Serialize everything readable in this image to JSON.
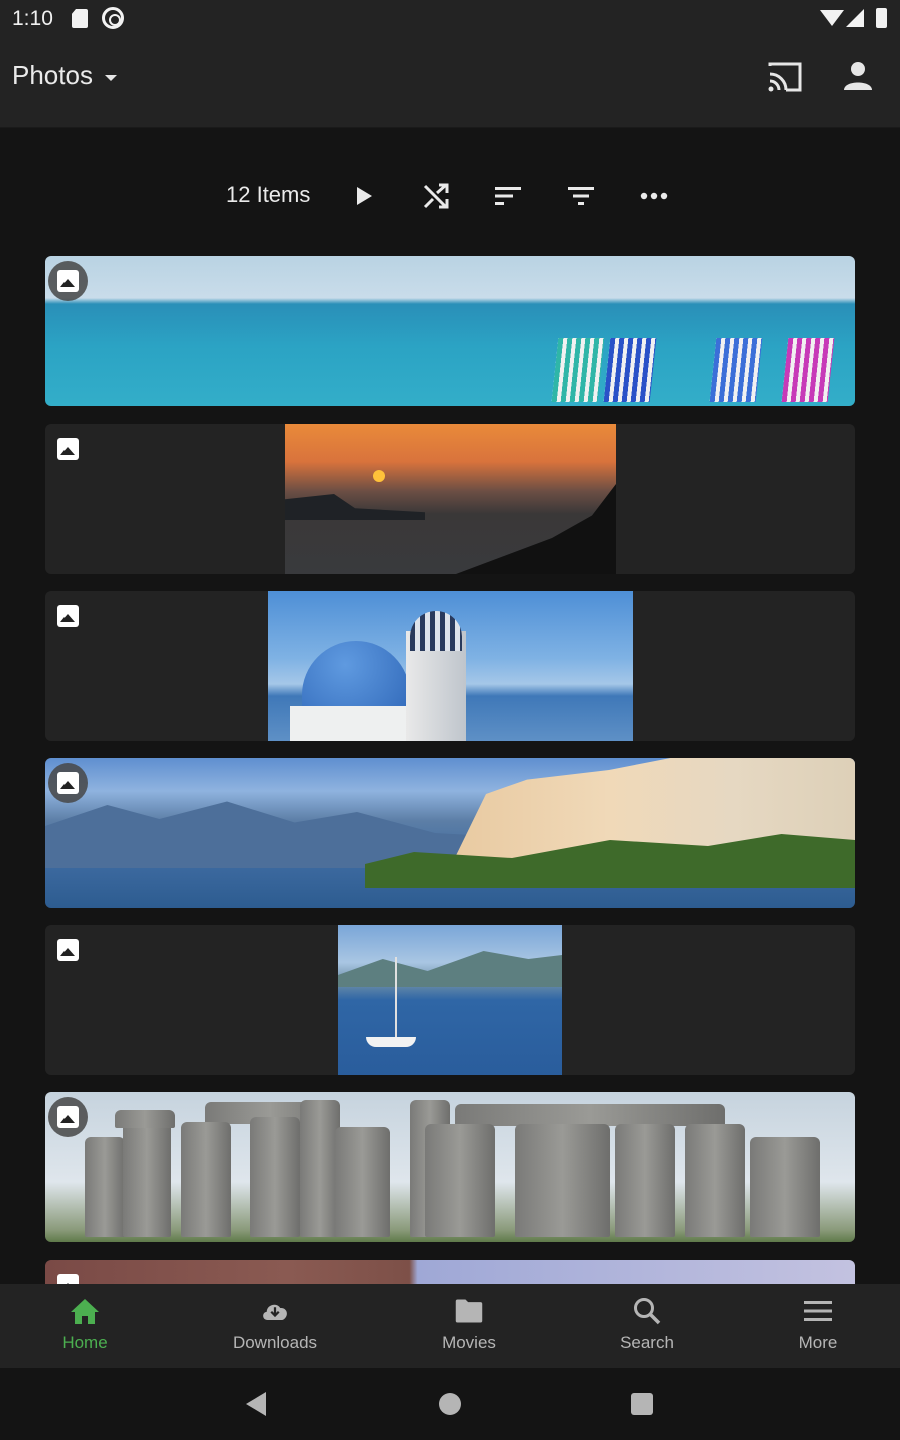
{
  "status_bar": {
    "time": "1:10",
    "icons": [
      "sd-card-icon",
      "a-notification-icon",
      "wifi-icon",
      "signal-icon",
      "battery-icon"
    ]
  },
  "app_bar": {
    "title": "Photos",
    "actions": [
      {
        "name": "cast",
        "icon": "cast-icon"
      },
      {
        "name": "user",
        "icon": "account-icon"
      }
    ]
  },
  "toolbar": {
    "item_count": "12 Items",
    "actions": [
      {
        "name": "play",
        "icon": "play-icon"
      },
      {
        "name": "shuffle",
        "icon": "shuffle-icon"
      },
      {
        "name": "sort",
        "icon": "sort-icon"
      },
      {
        "name": "filter",
        "icon": "filter-icon"
      },
      {
        "name": "more",
        "icon": "more-horizontal-icon"
      }
    ]
  },
  "photos": [
    {
      "subject": "Beach with striped deck chairs",
      "type": "photo"
    },
    {
      "subject": "Sunset over sea",
      "type": "photo"
    },
    {
      "subject": "Blue-domed church",
      "type": "photo"
    },
    {
      "subject": "Lakeside town and mountains",
      "type": "photo"
    },
    {
      "subject": "Sailboat on lake",
      "type": "photo"
    },
    {
      "subject": "Stonehenge",
      "type": "photo"
    },
    {
      "subject": "Castle and sky",
      "type": "photo"
    }
  ],
  "bottom_nav": {
    "active_color": "#4caf50",
    "items": [
      {
        "label": "Home",
        "icon": "home-icon",
        "active": true
      },
      {
        "label": "Downloads",
        "icon": "download-cloud-icon",
        "active": false
      },
      {
        "label": "Movies",
        "icon": "folder-icon",
        "active": false
      },
      {
        "label": "Search",
        "icon": "search-icon",
        "active": false
      },
      {
        "label": "More",
        "icon": "menu-icon",
        "active": false
      }
    ]
  }
}
